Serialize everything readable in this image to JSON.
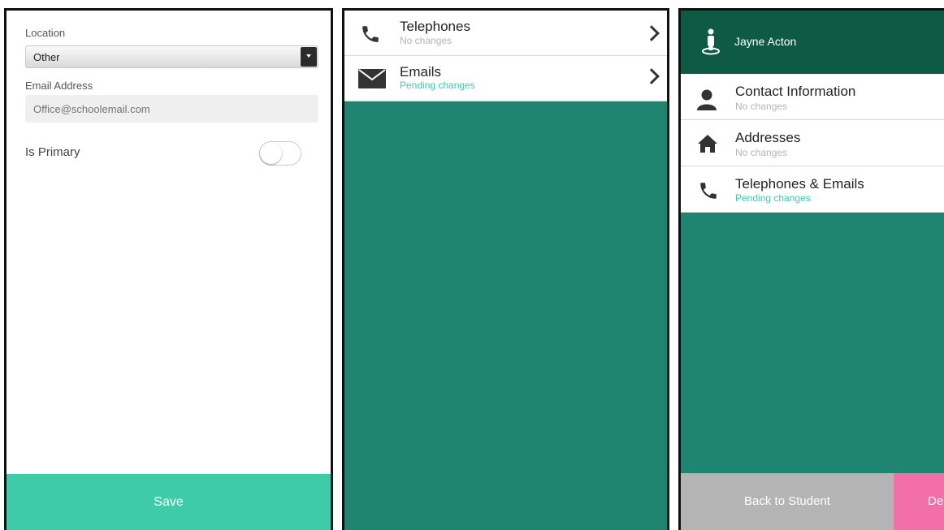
{
  "panel1": {
    "location_label": "Location",
    "location_value": "Other",
    "email_label": "Email Address",
    "email_placeholder": "Office@schoolemail.com",
    "primary_label": "Is Primary",
    "primary_on": false,
    "save_label": "Save"
  },
  "panel2": {
    "items": [
      {
        "title": "Telephones",
        "status": "No changes",
        "icon": "phone-icon"
      },
      {
        "title": "Emails",
        "status": "Pending changes",
        "icon": "envelope-icon"
      }
    ]
  },
  "panel3": {
    "header_name": "Jayne Acton",
    "items": [
      {
        "title": "Contact Information",
        "status": "No changes",
        "icon": "person-icon"
      },
      {
        "title": "Addresses",
        "status": "No changes",
        "icon": "home-icon"
      },
      {
        "title": "Telephones & Emails",
        "status": "Pending changes",
        "icon": "phone-icon"
      }
    ],
    "back_label": "Back to Student",
    "delete_label": "De"
  },
  "colors": {
    "teal_bg": "#1f8470",
    "header_dark": "#0e5a44",
    "save_green": "#3ecba7",
    "pending_text": "#3ecba7",
    "back_grey": "#b4b4b4",
    "delete_pink": "#f36fa8"
  }
}
